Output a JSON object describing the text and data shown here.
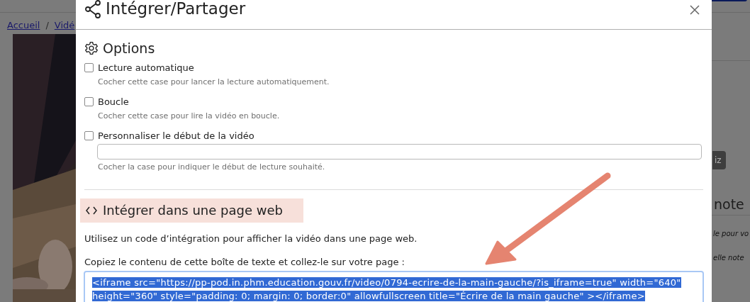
{
  "background_page": {
    "breadcrumb": [
      {
        "label": "Accueil"
      },
      {
        "label": "Vidé"
      }
    ],
    "breadcrumb_separator": "/",
    "side_texts": [
      {
        "text": "iz",
        "kind": "button"
      },
      {
        "text": "note",
        "kind": "heading"
      },
      {
        "text": "le pour vo",
        "kind": "note"
      },
      {
        "text": "elle note",
        "kind": "note"
      }
    ]
  },
  "modal": {
    "title": "Intégrer/Partager",
    "options": {
      "heading": "Options",
      "items": [
        {
          "kind": "checkbox",
          "label": "Lecture automatique",
          "checked": false,
          "help": "Cocher cette case pour lancer la lecture automatiquement."
        },
        {
          "kind": "checkbox",
          "label": "Boucle",
          "checked": false,
          "help": "Cocher cette case pour lire la vidéo en boucle."
        },
        {
          "kind": "checkbox_input",
          "label": "Personnaliser le début de la vidéo",
          "checked": false,
          "help": "Cocher la case pour indiquer le début de lecture souhaité."
        }
      ]
    },
    "embed": {
      "heading": "Intégrer dans une page web",
      "description": "Utilisez un code d’intégration pour afficher la vidéo dans une page web.",
      "label": "Copiez le contenu de cette boîte de texte et collez-le sur votre page :",
      "code_lines": [
        "<iframe src=\"https://pp-pod.in.phm.education.gouv.fr/video/0794-ecrire-de-la-main-gauche/?is_iframe=true\" width=\"640\"",
        "height=\"360\" style=\"padding: 0; margin: 0; border:0\" allowfullscreen title=\"Écrire de la main gauche\" ></iframe>"
      ],
      "selected": true
    }
  }
}
